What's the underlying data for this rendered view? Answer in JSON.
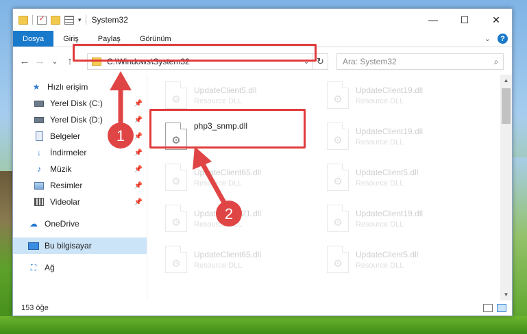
{
  "window": {
    "title": "System32",
    "controls": {
      "minimize": "—",
      "maximize": "☐",
      "close": "✕"
    }
  },
  "ribbon": {
    "tabs": [
      {
        "label": "Dosya"
      },
      {
        "label": "Giriş"
      },
      {
        "label": "Paylaş"
      },
      {
        "label": "Görünüm"
      }
    ],
    "expand_icon": "chevron-down-icon",
    "help_label": "?"
  },
  "navigation": {
    "back": "←",
    "forward": "→",
    "recent": "⌄",
    "up": "↑",
    "address": "C:\\Windows\\System32",
    "refresh": "↻"
  },
  "search": {
    "placeholder": "Ara: System32"
  },
  "sidebar": {
    "items": [
      {
        "label": "Hızlı erişim",
        "icon": "star-icon",
        "pinned": false
      },
      {
        "label": "Yerel Disk (C:)",
        "icon": "drive-icon",
        "pinned": true
      },
      {
        "label": "Yerel Disk (D:)",
        "icon": "drive-icon",
        "pinned": true
      },
      {
        "label": "Belgeler",
        "icon": "documents-icon",
        "pinned": true
      },
      {
        "label": "İndirmeler",
        "icon": "downloads-icon",
        "pinned": true
      },
      {
        "label": "Müzik",
        "icon": "music-icon",
        "pinned": true
      },
      {
        "label": "Resimler",
        "icon": "pictures-icon",
        "pinned": true
      },
      {
        "label": "Videolar",
        "icon": "videos-icon",
        "pinned": true
      },
      {
        "label": "OneDrive",
        "icon": "onedrive-icon",
        "pinned": false
      },
      {
        "label": "Bu bilgisayar",
        "icon": "this-pc-icon",
        "pinned": false,
        "selected": true
      },
      {
        "label": "Ağ",
        "icon": "network-icon",
        "pinned": false
      }
    ]
  },
  "files": [
    {
      "name": "UpdateClient5.dll",
      "type": "Resource DLL",
      "faded": true
    },
    {
      "name": "UpdateClient19.dll",
      "type": "Resource DLL",
      "faded": true
    },
    {
      "name": "php3_snmp.dll",
      "type": "",
      "faded": false,
      "highlighted": true
    },
    {
      "name": "UpdateClient19.dll",
      "type": "Resource DLL",
      "faded": true
    },
    {
      "name": "UpdateClient65.dll",
      "type": "Resource DLL",
      "faded": true
    },
    {
      "name": "UpdateClient5.dll",
      "type": "Resource DLL",
      "faded": true
    },
    {
      "name": "UpdateClient21.dll",
      "type": "Resource DLL",
      "faded": true
    },
    {
      "name": "UpdateClient19.dll",
      "type": "Resource DLL",
      "faded": true
    },
    {
      "name": "UpdateClient65.dll",
      "type": "Resource DLL",
      "faded": true
    },
    {
      "name": "UpdateClient5.dll",
      "type": "Resource DLL",
      "faded": true
    }
  ],
  "status": {
    "item_count": "153 öğe"
  },
  "annotations": [
    {
      "number": "1",
      "color": "#e04545"
    },
    {
      "number": "2",
      "color": "#e04545"
    }
  ],
  "colors": {
    "accent": "#1979ca",
    "highlight": "#e03a3a",
    "selected_bg": "#cce4f7"
  }
}
